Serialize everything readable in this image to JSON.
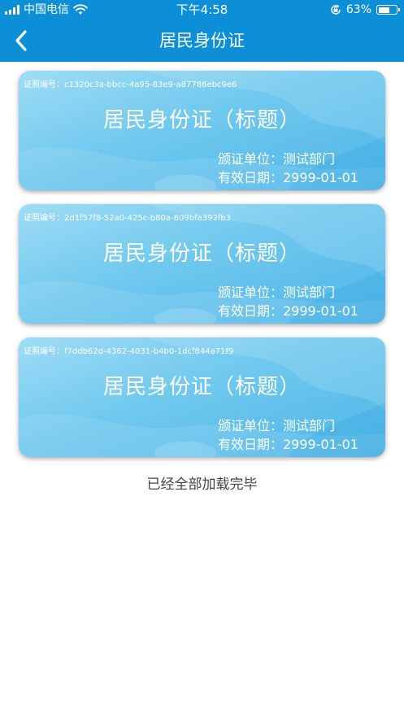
{
  "status_bar": {
    "carrier": "中国电信",
    "time": "下午4:58",
    "battery_percent": "63%",
    "battery_level": 0.63,
    "icons": [
      "signal-icon",
      "wifi-icon",
      "rotation-lock-icon",
      "battery-icon"
    ]
  },
  "nav": {
    "title": "居民身份证",
    "back_icon": "chevron-left-icon"
  },
  "colors": {
    "header": "#0d8fd8",
    "card_light": "#9fdcf6",
    "card_dark": "#4fb6e8"
  },
  "cards": [
    {
      "number_label": "证照编号：c1320c3a-bbcc-4a95-83e9-a87786ebc9e6",
      "title": "居民身份证（标题）",
      "issuer": "颁证单位：测试部门",
      "expiry": "有效日期：2999-01-01"
    },
    {
      "number_label": "证照编号：2d1f57f8-52a0-425c-b80a-809bfa392fb3",
      "title": "居民身份证（标题）",
      "issuer": "颁证单位：测试部门",
      "expiry": "有效日期：2999-01-01"
    },
    {
      "number_label": "证照编号：f7ddb62d-4362-4031-b4b0-1dcf844a71f9",
      "title": "居民身份证（标题）",
      "issuer": "颁证单位：测试部门",
      "expiry": "有效日期：2999-01-01"
    }
  ],
  "footer": {
    "end_text": "已经全部加载完毕"
  }
}
